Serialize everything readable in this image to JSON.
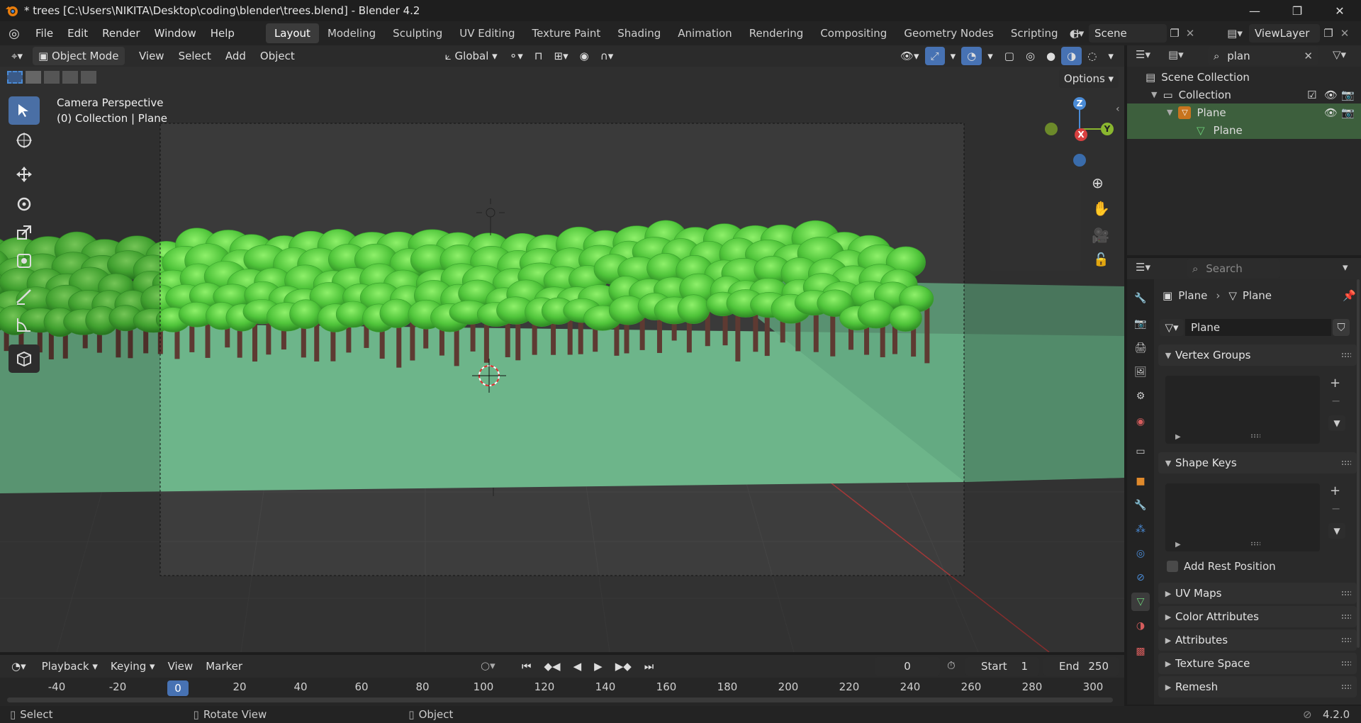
{
  "window": {
    "title": "* trees [C:\\Users\\NIKITA\\Desktop\\coding\\blender\\trees.blend] - Blender 4.2"
  },
  "menubar": {
    "menus": [
      "File",
      "Edit",
      "Render",
      "Window",
      "Help"
    ],
    "workspaces": [
      "Layout",
      "Modeling",
      "Sculpting",
      "UV Editing",
      "Texture Paint",
      "Shading",
      "Animation",
      "Rendering",
      "Compositing",
      "Geometry Nodes",
      "Scripting"
    ],
    "active_workspace": "Layout",
    "scene": "Scene",
    "view_layer": "ViewLayer"
  },
  "viewport_header": {
    "mode": "Object Mode",
    "menus": [
      "View",
      "Select",
      "Add",
      "Object"
    ],
    "orientation": "Global",
    "options": "Options"
  },
  "viewport": {
    "overlay_line1": "Camera Perspective",
    "overlay_line2": "(0) Collection | Plane",
    "gizmo_axes": [
      "Z",
      "X",
      "Y"
    ]
  },
  "outliner": {
    "search_value": "plan",
    "items": [
      {
        "label": "Scene Collection"
      },
      {
        "label": "Collection"
      },
      {
        "label": "Plane"
      },
      {
        "label": "Plane"
      }
    ]
  },
  "properties": {
    "search_placeholder": "Search",
    "breadcrumb": [
      "Plane",
      "Plane"
    ],
    "mesh_name": "Plane",
    "panels": {
      "vertex_groups": "Vertex Groups",
      "shape_keys": "Shape Keys",
      "add_rest_position": "Add Rest Position",
      "uv_maps": "UV Maps",
      "color_attributes": "Color Attributes",
      "attributes": "Attributes",
      "texture_space": "Texture Space",
      "remesh": "Remesh"
    }
  },
  "timeline": {
    "menus": [
      "Playback",
      "Keying",
      "View",
      "Marker"
    ],
    "current_frame": "0",
    "start_label": "Start",
    "start_value": "1",
    "end_label": "End",
    "end_value": "250",
    "ticks": [
      "-40",
      "-20",
      "0",
      "20",
      "40",
      "60",
      "80",
      "100",
      "120",
      "140",
      "160",
      "180",
      "200",
      "220",
      "240",
      "260",
      "280",
      "300"
    ],
    "playhead": "0"
  },
  "statusbar": {
    "select": "Select",
    "rotate_view": "Rotate View",
    "object": "Object",
    "version": "4.2.0"
  },
  "colors": {
    "accent": "#4772b3",
    "selection_green": "#3d5f3d",
    "foliage": "#5fd24a",
    "ground": "#6db58a"
  }
}
